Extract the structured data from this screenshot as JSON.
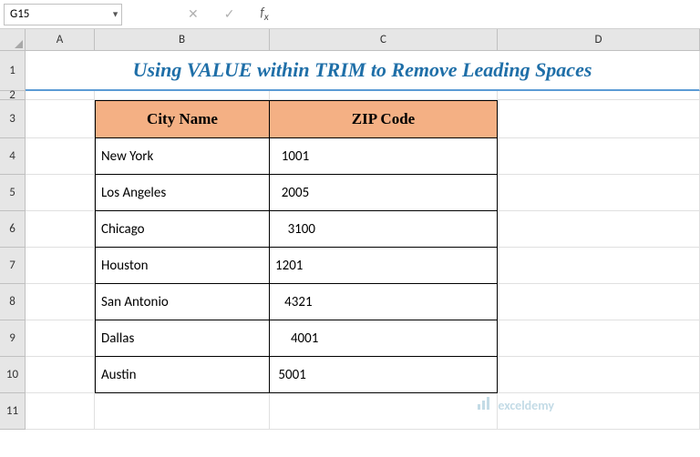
{
  "nameBox": "G15",
  "formulaInput": "",
  "colHeaders": [
    "A",
    "B",
    "C",
    "D"
  ],
  "rowHeaders": [
    "1",
    "2",
    "3",
    "4",
    "5",
    "6",
    "7",
    "8",
    "9",
    "10",
    "11"
  ],
  "title": "Using VALUE within TRIM to Remove Leading Spaces",
  "tableHeaders": {
    "city": "City Name",
    "zip": "ZIP Code"
  },
  "tableRows": [
    {
      "city": "New York",
      "zip": "  1001"
    },
    {
      "city": "Los Angeles",
      "zip": "  2005"
    },
    {
      "city": "Chicago",
      "zip": "    3100"
    },
    {
      "city": "Houston",
      "zip": "1201"
    },
    {
      "city": "San Antonio",
      "zip": "   4321"
    },
    {
      "city": "Dallas",
      "zip": "     4001"
    },
    {
      "city": "Austin",
      "zip": " 5001"
    }
  ],
  "watermark": "exceldemy",
  "colWidths": {
    "A": 76,
    "B": 192,
    "C": 250,
    "D": 222
  },
  "rowHeights": {
    "1": 44,
    "2": 10,
    "3": 42,
    "4": 40,
    "5": 40,
    "6": 40,
    "7": 40,
    "8": 40,
    "9": 40,
    "10": 40,
    "11": 40
  }
}
